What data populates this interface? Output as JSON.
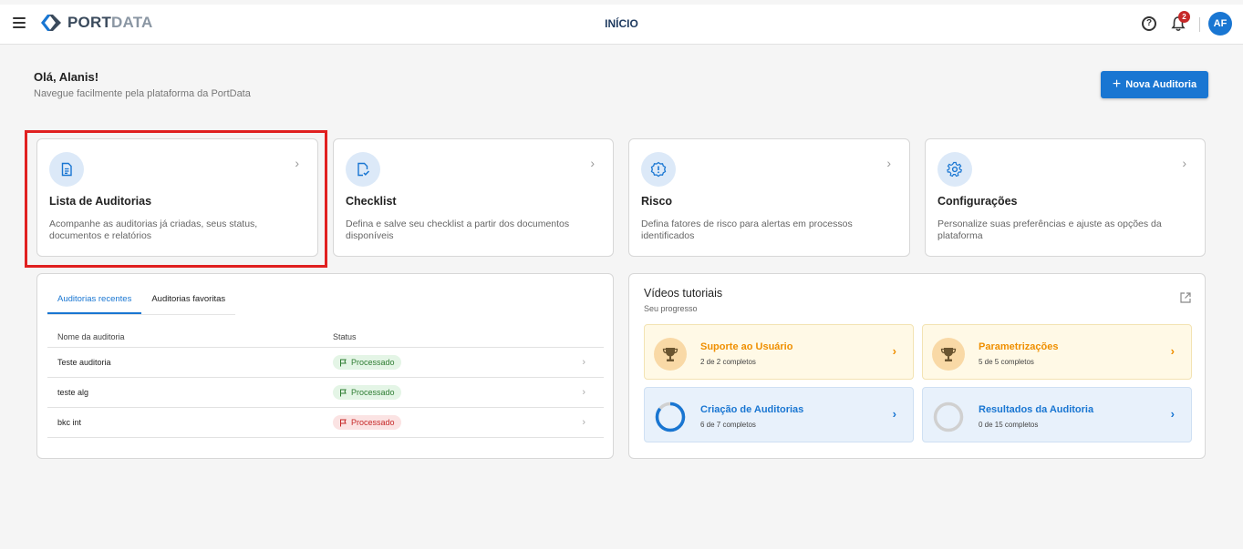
{
  "header": {
    "logo_strong": "PORT",
    "logo_light": "DATA",
    "page_title": "INÍCIO",
    "notification_count": "2",
    "avatar_initials": "AF",
    "help_glyph": "?"
  },
  "welcome": {
    "greeting": "Olá, Alanis!",
    "subtitle": "Navegue facilmente pela plataforma da PortData",
    "new_audit_label": "Nova Auditoria"
  },
  "cards": [
    {
      "title": "Lista de Auditorias",
      "description": "Acompanhe as auditorias já criadas, seus status, documentos e relatórios",
      "icon": "document-icon"
    },
    {
      "title": "Checklist",
      "description": "Defina e salve seu checklist a partir dos documentos disponíveis",
      "icon": "document-check-icon"
    },
    {
      "title": "Risco",
      "description": "Defina fatores de risco para alertas em processos identificados",
      "icon": "alert-icon"
    },
    {
      "title": "Configurações",
      "description": "Personalize suas preferências e ajuste as opções da plataforma",
      "icon": "gear-icon"
    }
  ],
  "audits": {
    "tabs": [
      "Auditorias recentes",
      "Auditorias favoritas"
    ],
    "active_tab": 0,
    "columns": [
      "Nome da auditoria",
      "Status"
    ],
    "rows": [
      {
        "name": "Teste auditoria",
        "status": "Processado",
        "status_type": "success"
      },
      {
        "name": "teste alg",
        "status": "Processado",
        "status_type": "success"
      },
      {
        "name": "bkc int",
        "status": "Processado",
        "status_type": "error"
      }
    ]
  },
  "tutorials": {
    "title": "Vídeos tutoriais",
    "subtitle": "Seu progresso",
    "items": [
      {
        "name": "Suporte ao Usuário",
        "progress": "2 de 2 completos",
        "completed": 2,
        "total": 2
      },
      {
        "name": "Parametrizações",
        "progress": "5 de 5 completos",
        "completed": 5,
        "total": 5
      },
      {
        "name": "Criação de Auditorias",
        "progress": "6 de 7 completos",
        "completed": 6,
        "total": 7
      },
      {
        "name": "Resultados da Auditoria",
        "progress": "0 de 15 completos",
        "completed": 0,
        "total": 15
      }
    ]
  },
  "colors": {
    "primary": "#1976d2",
    "highlight": "#e02020",
    "success": "#2e7d32",
    "error": "#c62828",
    "warning": "#ef8f00"
  }
}
